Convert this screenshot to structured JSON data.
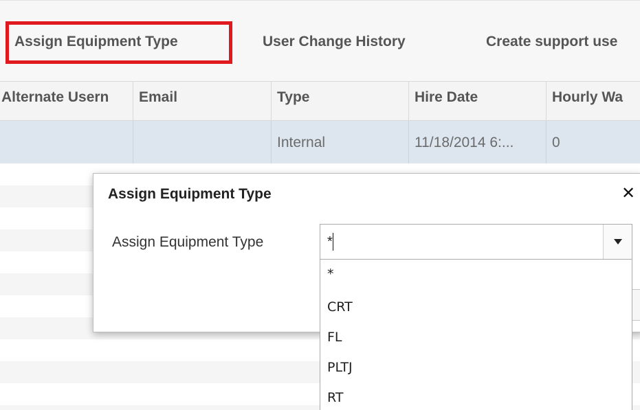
{
  "toolbar": {
    "items": [
      {
        "label": "Assign Equipment Type"
      },
      {
        "label": "User Change History"
      },
      {
        "label": "Create support use"
      }
    ]
  },
  "grid": {
    "columns": [
      "Alternate Usern",
      "Email",
      "Type",
      "Hire Date",
      "Hourly Wa"
    ],
    "row": [
      "",
      "",
      "Internal",
      "11/18/2014 6:...",
      "0"
    ]
  },
  "dialog": {
    "title": "Assign Equipment Type",
    "close_symbol": "✕",
    "field_label": "Assign Equipment Type",
    "input_value": "*",
    "options": [
      "*",
      "CRT",
      "FL",
      "PLTJ",
      "RT"
    ]
  },
  "colors": {
    "highlight": "#e0191f",
    "selected_row": "#dde6ef"
  }
}
